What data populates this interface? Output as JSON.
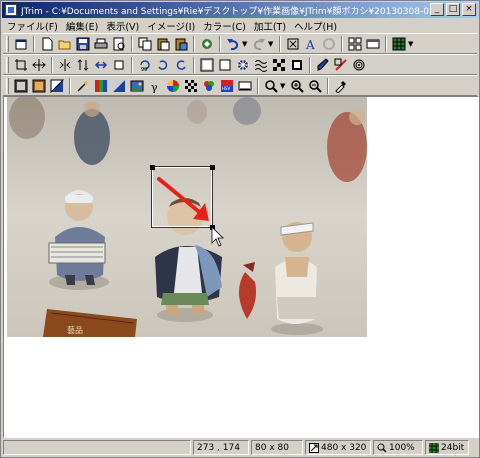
{
  "window": {
    "title": "JTrim - C:¥Documents and Settings¥Rie¥デスクトップ¥作業画像¥JTrim¥顔ボカシ¥20130308-01.jpg",
    "minimize_glyph": "_",
    "maximize_glyph": "□",
    "close_glyph": "×"
  },
  "menu": {
    "items": [
      {
        "label": "ファイル(F)"
      },
      {
        "label": "編集(E)"
      },
      {
        "label": "表示(V)"
      },
      {
        "label": "イメージ(I)"
      },
      {
        "label": "カラー(C)"
      },
      {
        "label": "加工(T)"
      },
      {
        "label": "ヘルプ(H)"
      }
    ]
  },
  "toolbar1": {
    "tools": [
      "new-window-icon",
      "new-file-icon",
      "open-icon",
      "save-icon",
      "print-icon",
      "print-preview-icon",
      "copy-icon",
      "paste-icon",
      "paste-new-icon",
      "capture-icon",
      "undo-icon",
      "redo-icon",
      "fit-icon",
      "text-icon",
      "settings-icon",
      "grid-view-icon",
      "panel-icon",
      "color-grid-icon"
    ]
  },
  "toolbar2": {
    "tools": [
      "crop-icon",
      "resize-icon",
      "mirror-icon",
      "flip-icon",
      "move-icon",
      "rotate-90-icon",
      "rotate-left-icon",
      "rotate-right-icon",
      "border-icon",
      "frame-icon",
      "sharpen-icon",
      "blur-icon",
      "mosaic-icon",
      "effect-icon",
      "pixelate-icon",
      "brush-icon",
      "draw-icon",
      "spiral-icon"
    ]
  },
  "toolbar3": {
    "tools": [
      "grayscale-icon",
      "sepia-icon",
      "tint-icon",
      "magic-icon",
      "color-icon",
      "contrast-icon",
      "image-icon",
      "gamma-icon",
      "palette-icon",
      "noise-icon",
      "rgb-icon",
      "hsv-icon",
      "trace-icon",
      "zoom-icon",
      "zoom-in-icon",
      "zoom-out-icon",
      "eyedropper-icon"
    ]
  },
  "status": {
    "cursor_pos": "273 , 174",
    "selection_size": "80 x 80",
    "image_size": "480 x 320",
    "zoom": "100%",
    "depth": "24bit"
  },
  "colors": {
    "selection_arrow": "#e8201a",
    "title_start": "#0a246a",
    "title_end": "#a6caf0"
  }
}
